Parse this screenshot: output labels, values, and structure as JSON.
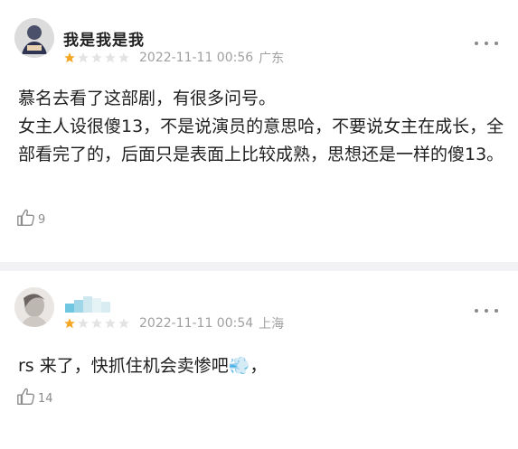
{
  "comments": [
    {
      "username": "我是我是我",
      "rating": 1,
      "date": "2022-11-11 00:56",
      "location": "广东",
      "lines": [
        "慕名去看了这部剧，有很多问号。",
        "女主人设很傻13，不是说演员的意思哈，不要说女主在成长，全部看完了的，后面只是表面上比较成熟，思想还是一样的傻13。"
      ],
      "likes": "9"
    },
    {
      "username": "",
      "rating": 1,
      "date": "2022-11-11 00:54",
      "location": "上海",
      "lines": [
        "rs 来了，快抓住机会卖惨吧💨，"
      ],
      "likes": "14"
    }
  ],
  "colors": {
    "star_filled": "#f5a623",
    "star_empty": "#e3e3e3",
    "meta": "#a0a0a0"
  },
  "icons": [
    "more-icon",
    "thumbs-up-icon",
    "star-icon"
  ]
}
